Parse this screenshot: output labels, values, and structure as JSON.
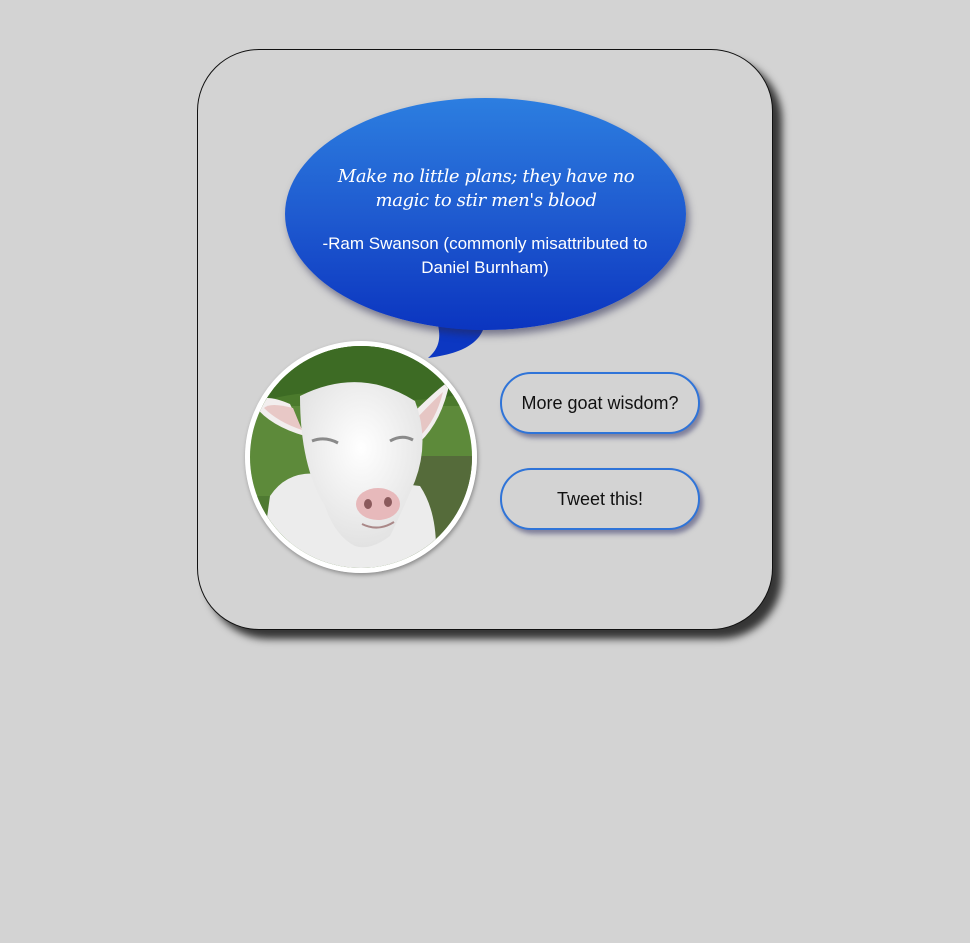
{
  "quote": {
    "text": "Make no little plans; they have no magic to stir men's blood",
    "author": "-Ram Swanson (commonly misattributed to Daniel Burnham)"
  },
  "buttons": {
    "more_label": "More goat wisdom?",
    "tweet_label": "Tweet this!"
  },
  "avatar": {
    "icon": "goat-photo"
  },
  "colors": {
    "page_background": "#d3d3d3",
    "bubble_top": "#2c7ee0",
    "bubble_bottom": "#0b35c0",
    "button_border": "#2f74d8"
  }
}
